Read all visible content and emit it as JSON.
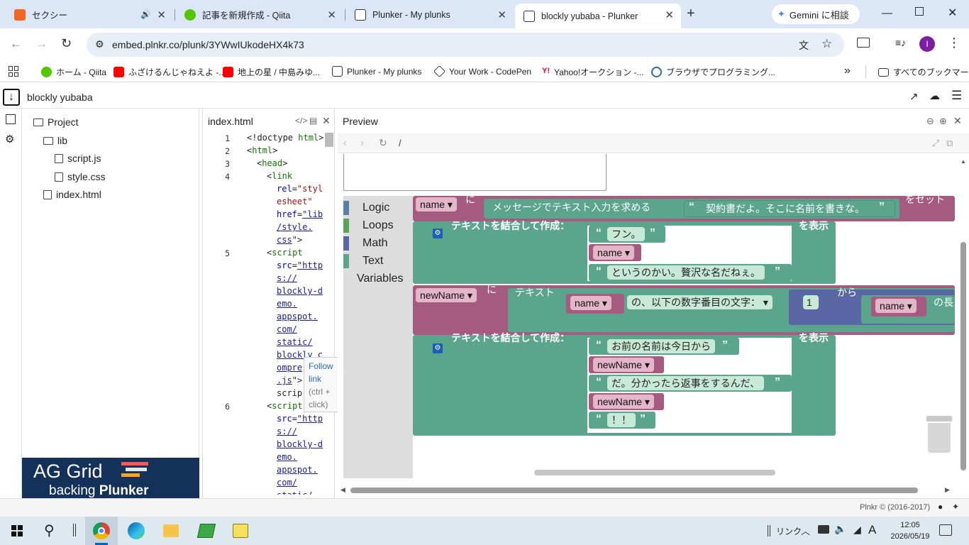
{
  "browser": {
    "tabs": [
      {
        "title": "セクシー",
        "favicon_color": "#f26522"
      },
      {
        "title": "記事を新規作成 - Qiita",
        "favicon_color": "#55c500"
      },
      {
        "title": "Plunker - My plunks",
        "favicon_color": "#333333"
      },
      {
        "title": "blockly yubaba - Plunker",
        "favicon_color": "#333333"
      }
    ],
    "gemini_label": "Gemini に相談",
    "url": "embed.plnkr.co/plunk/3YWwIUkodeHX4k73",
    "profile_initial": "I",
    "bookmarks": [
      {
        "label": "ホーム - Qiita",
        "color": "#55c500"
      },
      {
        "label": "ふざけるんじゃねえよ -...",
        "color": "#ff0000"
      },
      {
        "label": "地上の星 / 中島みゆ...",
        "color": "#ff0000"
      },
      {
        "label": "Plunker - My plunks",
        "color": "#333333"
      },
      {
        "label": "Your Work - CodePen",
        "color": "#111111"
      },
      {
        "label": "Yahoo!オークション -...",
        "color": "#ff0033"
      },
      {
        "label": "ブラウザでプログラミング...",
        "color": "#2c6e99"
      }
    ],
    "all_bookmarks": "すべてのブックマーク"
  },
  "plunker": {
    "title": "blockly yubaba",
    "tree": {
      "project": "Project",
      "lib": "lib",
      "files": [
        "script.js",
        "style.css"
      ],
      "index": "index.html"
    },
    "ad": {
      "line1": "AG Grid",
      "line2a": "backing ",
      "line2b": "Plunker"
    },
    "editor": {
      "filename": "index.html",
      "line_numbers": [
        "1",
        "2",
        "3",
        "4",
        "5",
        "6"
      ],
      "tooltip": {
        "l1": "Follow",
        "l2": "link",
        "l3": "(ctrl +",
        "l4": "click)"
      }
    },
    "preview": {
      "label": "Preview",
      "path": "/"
    },
    "footer": "Plnkr © (2016-2017)"
  },
  "blockly": {
    "categories": [
      "Logic",
      "Loops",
      "Math",
      "Text",
      "Variables"
    ],
    "category_colors": [
      "#5b80a5",
      "#5ba55b",
      "#5b67a5",
      "#5ba58c",
      "#a55b80"
    ],
    "set1": {
      "var": "name",
      "to": "に",
      "prompt": "メッセージでテキスト入力を求める",
      "msg": "契約書だよ。そこに名前を書きな。",
      "set": "をセット"
    },
    "print1": {
      "join": "テキストを結合して作成：",
      "show": "を表示",
      "t1": "フン。",
      "v1": "name",
      "t2": "というのかい。贅沢な名だねぇ。"
    },
    "set2": {
      "var": "newName",
      "to": "に",
      "text": "テキスト",
      "v": "name",
      "mid": "の、以下の数字番目の文字：",
      "num": "1",
      "from": "から",
      "v2": "name",
      "len": "の長"
    },
    "print2": {
      "join": "テキストを結合して作成：",
      "show": "を表示",
      "t1": "お前の名前は今日から",
      "v1": "newName",
      "t2": "だ。分かったら返事をするんだ、",
      "v2": "newName",
      "t3": "！！"
    }
  },
  "taskbar": {
    "time": "12:05",
    "date": "2026/05/19",
    "link_label": "リンク",
    "ime": "A"
  }
}
